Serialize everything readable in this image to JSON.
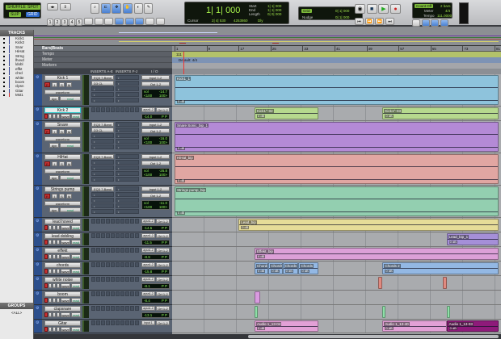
{
  "toolbar": {
    "modes": {
      "shuffle": "SHUFFLE",
      "spot": "SPOT",
      "slip": "SLIP",
      "grid": "GRID"
    },
    "main_counter": "1| 1| 000",
    "start_label": "Start",
    "end_label": "End",
    "length_label": "Length",
    "start": "1| 1| 000",
    "end": "1| 1| 000",
    "length": "0| 0| 000",
    "cursor_label": "Cursor",
    "cursor_value": "2| 4| 530",
    "sample_value": "4253860",
    "dly_label": "Dly",
    "grid_label": "Grid",
    "grid_value": "0| 1| 000",
    "nudge_label": "Nudge",
    "nudge_value": "0| 1| 000",
    "count_off": "Count Off",
    "bars": "2 bars",
    "meter_label": "Meter",
    "meter_value": "4/4",
    "tempo_label": "Tempo",
    "tempo_value": "111.0000",
    "number_buttons": [
      "1",
      "2",
      "3",
      "4",
      "5"
    ]
  },
  "tracks_panel": {
    "title": "TRACKS",
    "items": [
      "Kick1",
      "Kick2",
      "Snar",
      "HiHat",
      "Strng",
      "lhovd",
      "ldobl",
      "effkt",
      "chrd",
      "white",
      "boom",
      "clpsn",
      "Gitar",
      "Mst1"
    ]
  },
  "groups_panel": {
    "title": "GROUPS",
    "all": "<ALL>"
  },
  "rulers": {
    "bars_beats": "Bars|Beats",
    "tempo": "Tempo",
    "meter": "Meter",
    "markers": "Markers",
    "tempo_marker": "111",
    "meter_marker": "Default: 4/4",
    "bar_labels": [
      "1",
      "9",
      "17",
      "25",
      "33",
      "41",
      "49",
      "57",
      "65",
      "73",
      "81"
    ]
  },
  "columns": {
    "inserts_ae": "INSERTS A-E",
    "inserts_fj": "INSERTS F-J",
    "io": "I / O"
  },
  "labels": {
    "waveform": "waveform",
    "dyn": "dyn",
    "read": "read",
    "wave": "wave",
    "vol": "vol",
    "pan_l": "<100",
    "pan_r": "100>",
    "p": "P",
    "r": "R",
    "i": "I",
    "s": "S",
    "m": "M"
  },
  "tracks": [
    {
      "name": "Kick 1",
      "size": "big",
      "input": "input 1-2",
      "output": "Out 1-2",
      "vol": "-14.7",
      "inserts": [
        "EQ3 7-Band",
        "D3 CL"
      ],
      "clips": [
        {
          "name": "Kick1_1",
          "start": 1,
          "end": 82,
          "color": "#8ec3dc"
        }
      ]
    },
    {
      "name": "Kick 2",
      "size": "small",
      "selected": true,
      "input": "aysn1-2",
      "output": "Ort 1-2",
      "vol": "-14.0",
      "clips": [
        {
          "name": "Kick1^-02",
          "start": 21,
          "end": 37,
          "color": "#b6d98e"
        },
        {
          "name": "Kick1^-03",
          "start": 53,
          "end": 82,
          "color": "#b6d98e"
        }
      ]
    },
    {
      "name": "Snare",
      "size": "big",
      "input": "input 1-2",
      "output": "Out 1-2",
      "vol": "-16.0",
      "inserts": [
        "EQ3 7-Band",
        "D3 CL"
      ],
      "clips": [
        {
          "name": "Snare Sonic_bip_1",
          "start": 1,
          "end": 82,
          "color": "#b48ad6"
        }
      ]
    },
    {
      "name": "HiHat",
      "size": "big",
      "input": "input 1-2",
      "output": "Out 1-2",
      "vol": "-26.8",
      "inserts": [
        "EQ3 7-Band"
      ],
      "clips": [
        {
          "name": "HiHat_bip",
          "start": 1,
          "end": 82,
          "color": "#e1a6a2"
        }
      ]
    },
    {
      "name": "Strings pump",
      "size": "big",
      "input": "input 1-2",
      "output": "Out 1-2",
      "vol": "-11.0",
      "inserts": [
        "EQ3 7-Band"
      ],
      "clips": [
        {
          "name": "Strings pump_bip",
          "start": 1,
          "end": 82,
          "color": "#93cfb0"
        }
      ]
    },
    {
      "name": "lead hoved",
      "size": "small",
      "input": "aysn1-2",
      "output": "Ort 1-2",
      "vol": "-14.5",
      "clips": [
        {
          "name": "Lead_bip",
          "start": 17,
          "end": 82,
          "color": "#e6dc98"
        }
      ]
    },
    {
      "name": "lead dobling",
      "size": "small",
      "input": "aysn1-2",
      "output": "Ort 1-2",
      "vol": "-11.5",
      "clips": [
        {
          "name": "Lead_bip_1",
          "start": 69,
          "end": 82,
          "color": "#a58fd8"
        }
      ]
    },
    {
      "name": "effekt",
      "size": "small",
      "input": "aysn1-2",
      "output": "Ort 1-2",
      "vol": "-8.9",
      "clips": [
        {
          "name": "Effekt_bip",
          "start": 21,
          "end": 82,
          "color": "#dca0d8"
        }
      ]
    },
    {
      "name": "chords",
      "size": "small",
      "input": "aysn1-2",
      "output": "Ort 1-2",
      "vol": "-15.8",
      "clips": [
        {
          "name": "Chords",
          "start": 21,
          "end": 24.5,
          "color": "#93b8e4"
        },
        {
          "name": "Chords",
          "start": 24.5,
          "end": 28,
          "color": "#93b8e4"
        },
        {
          "name": "Chords",
          "start": 28,
          "end": 32,
          "color": "#93b8e4"
        },
        {
          "name": "Chords",
          "start": 32,
          "end": 37,
          "color": "#93b8e4"
        },
        {
          "name": "Chords 2",
          "start": 53,
          "end": 82,
          "color": "#93b8e4"
        }
      ]
    },
    {
      "name": "white noise",
      "size": "small",
      "input": "aysn1-2",
      "output": "Ort 1-2",
      "vol": "-8.1",
      "clips": [
        {
          "start": 52,
          "end": 53,
          "color": "#e08a80"
        },
        {
          "start": 68,
          "end": 69,
          "color": "#e08a80"
        }
      ]
    },
    {
      "name": "boom",
      "size": "small",
      "input": "aysn1-2",
      "output": "Ort 1-2",
      "vol": "-8.4",
      "clips": [
        {
          "start": 21,
          "end": 22.5,
          "color": "#d99ae0"
        }
      ]
    },
    {
      "name": "clapsnare",
      "size": "small",
      "input": "aysn1-2",
      "output": "Ort 1-2",
      "vol": "-13.1",
      "clips": [
        {
          "start": 21,
          "end": 21.8,
          "color": "#8ee0a8"
        },
        {
          "start": 53,
          "end": 53.8,
          "color": "#8ee0a8"
        },
        {
          "start": 69,
          "end": 69.8,
          "color": "#8ee0a8"
        }
      ]
    },
    {
      "name": "Gitar",
      "size": "tiny",
      "input": "input 1",
      "output": "Ort 1-2",
      "clips": [
        {
          "name": "Audio 1_13-04",
          "start": 21,
          "end": 37,
          "color": "#e2a0d6"
        },
        {
          "name": "Audio 1_13-40",
          "start": 53,
          "end": 69,
          "color": "#e2a0d6"
        },
        {
          "name": "Audio 1_13-03",
          "start": 69,
          "end": 82,
          "color": "#8e1a7a"
        }
      ]
    }
  ],
  "gain_label": "0 dB"
}
